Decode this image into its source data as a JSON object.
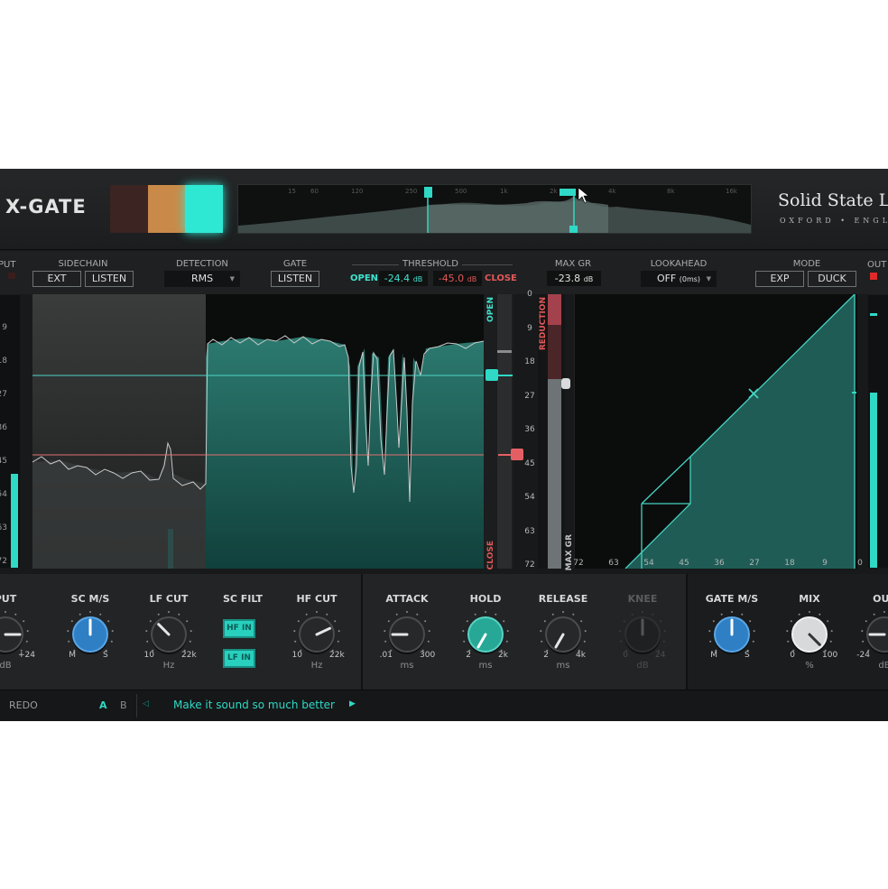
{
  "header": {
    "title": "X-GATE",
    "brand_line1": "Solid State Lo",
    "brand_line2": "OXFORD • ENGL",
    "swatches": [
      "#3b2421",
      "#c98a49",
      "#2fe8d4"
    ],
    "spectrum_labels": [
      "15",
      "60",
      "120",
      "250",
      "500",
      "1k",
      "2k",
      "4k",
      "8k",
      "16k"
    ]
  },
  "controls": {
    "input_label": "PUT",
    "sidechain": {
      "label": "SIDECHAIN",
      "ext": "EXT",
      "listen": "LISTEN"
    },
    "detection": {
      "label": "DETECTION",
      "value": "RMS"
    },
    "gate": {
      "label": "GATE",
      "listen": "LISTEN"
    },
    "threshold": {
      "label": "THRESHOLD",
      "open_label": "OPEN",
      "open_value": "-24.4",
      "close_value": "-45.0",
      "unit": "dB",
      "close_label": "CLOSE"
    },
    "max_gr": {
      "label": "MAX GR",
      "value": "-23.8",
      "unit": "dB"
    },
    "lookahead": {
      "label": "LOOKAHEAD",
      "value": "OFF",
      "sub": "(0ms)"
    },
    "mode": {
      "label": "MODE",
      "exp": "EXP",
      "duck": "DUCK"
    },
    "output_label": "OUT"
  },
  "display": {
    "scale": [
      "0",
      "9",
      "18",
      "27",
      "36",
      "45",
      "54",
      "63",
      "72"
    ],
    "left_scale": [
      "9",
      "18",
      "27",
      "36",
      "45",
      "54",
      "63",
      "72"
    ],
    "gr_x_scale": [
      "72",
      "63",
      "54",
      "45",
      "36",
      "27",
      "18",
      "9",
      "0"
    ],
    "open_vertical": "OPEN",
    "close_vertical": "CLOSE",
    "reduction_vertical": "REDUCTION",
    "max_gr_vertical": "MAX GR",
    "open_threshold_db": -24.4,
    "close_threshold_db": -45.0,
    "max_gr_db": -23.8
  },
  "knobs": [
    {
      "label": "PUT",
      "min": "",
      "max": "+24",
      "unit": "dB",
      "color": "dark",
      "angle": 90
    },
    {
      "label": "SC M/S",
      "min": "M",
      "max": "S",
      "unit": "",
      "color": "blue",
      "angle": 0
    },
    {
      "label": "LF CUT",
      "min": "10",
      "max": "22k",
      "unit": "Hz",
      "color": "dark",
      "angle": -45
    },
    {
      "label": "HF CUT",
      "min": "10",
      "max": "22k",
      "unit": "Hz",
      "color": "dark",
      "angle": 65
    },
    {
      "label": "ATTACK",
      "min": ".01",
      "max": "300",
      "unit": "ms",
      "color": "dark",
      "angle": -90
    },
    {
      "label": "HOLD",
      "min": "2",
      "max": "2k",
      "unit": "ms",
      "color": "teal",
      "angle": -150
    },
    {
      "label": "RELEASE",
      "min": "2",
      "max": "4k",
      "unit": "ms",
      "color": "dark",
      "angle": -150
    },
    {
      "label": "KNEE",
      "min": "0",
      "max": "24",
      "unit": "dB",
      "color": "disabled",
      "angle": 0
    },
    {
      "label": "GATE M/S",
      "min": "M",
      "max": "S",
      "unit": "",
      "color": "blue",
      "angle": 0
    },
    {
      "label": "MIX",
      "min": "0",
      "max": "100",
      "unit": "%",
      "color": "white",
      "angle": 135
    },
    {
      "label": "OUT",
      "min": "-24",
      "max": "",
      "unit": "dB",
      "color": "dark",
      "angle": -90
    }
  ],
  "sc_filt": {
    "label": "SC FILT",
    "hf_in": "HF IN",
    "lf_in": "LF IN"
  },
  "footer": {
    "redo": "REDO",
    "a": "A",
    "b": "B",
    "preset_name": "Make it sound so much better"
  },
  "colors": {
    "accent": "#2fd9c6",
    "close_red": "#e15858",
    "panel": "#17191a"
  }
}
